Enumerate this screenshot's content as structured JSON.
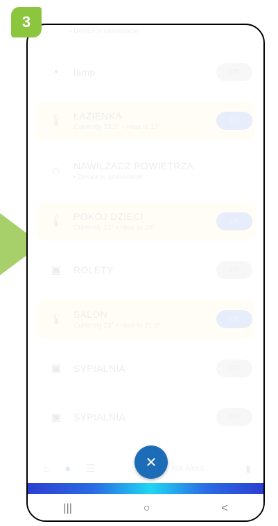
{
  "step_number": "3",
  "top_partial_text": "• Device is unavailable",
  "devices": [
    {
      "name": "lamp",
      "subtitle": "",
      "icon": "outlet-icon",
      "toggle": "Off",
      "toggle_state": "off",
      "warm": false
    },
    {
      "name": "ŁAZIENKA",
      "subtitle": "Currently 23.5° • Heat to 15°",
      "icon": "thermometer-icon",
      "toggle": "On",
      "toggle_state": "on",
      "warm": true
    },
    {
      "name": "NAWILŻACZ POWIETRZA",
      "subtitle": "• Device is unavailable",
      "icon": "home-icon",
      "toggle": "",
      "toggle_state": "none",
      "warm": false
    },
    {
      "name": "POKÓJ DZIECI",
      "subtitle": "Currently 21° • Heat to 20°",
      "icon": "thermometer-icon",
      "toggle": "On",
      "toggle_state": "on",
      "warm": true
    },
    {
      "name": "ROLETY",
      "subtitle": "",
      "icon": "switch-icon",
      "toggle": "Off",
      "toggle_state": "off",
      "warm": false
    },
    {
      "name": "SALON",
      "subtitle": "Currently 23° • Heat to 21.5°",
      "icon": "thermometer-icon",
      "toggle": "On",
      "toggle_state": "on",
      "warm": true
    },
    {
      "name": "SYPIALNIA",
      "subtitle": "",
      "icon": "switch-icon",
      "toggle": "Off",
      "toggle_state": "off",
      "warm": false
    },
    {
      "name": "SYPIALNIA",
      "subtitle": "",
      "icon": "switch-icon",
      "toggle": "Off",
      "toggle_state": "off",
      "warm": false
    }
  ],
  "bottom_nav": {
    "ask_text": "Ask Alexa...",
    "items": [
      "home-icon",
      "devices-icon",
      "menu-icon"
    ]
  },
  "fab_icon": "close-icon",
  "system_nav": {
    "recents": "|||",
    "home": "○",
    "back": "<"
  },
  "colors": {
    "fab": "#1c6cb7",
    "badge": "#8cc63f",
    "arrow": "#a8d06a"
  }
}
